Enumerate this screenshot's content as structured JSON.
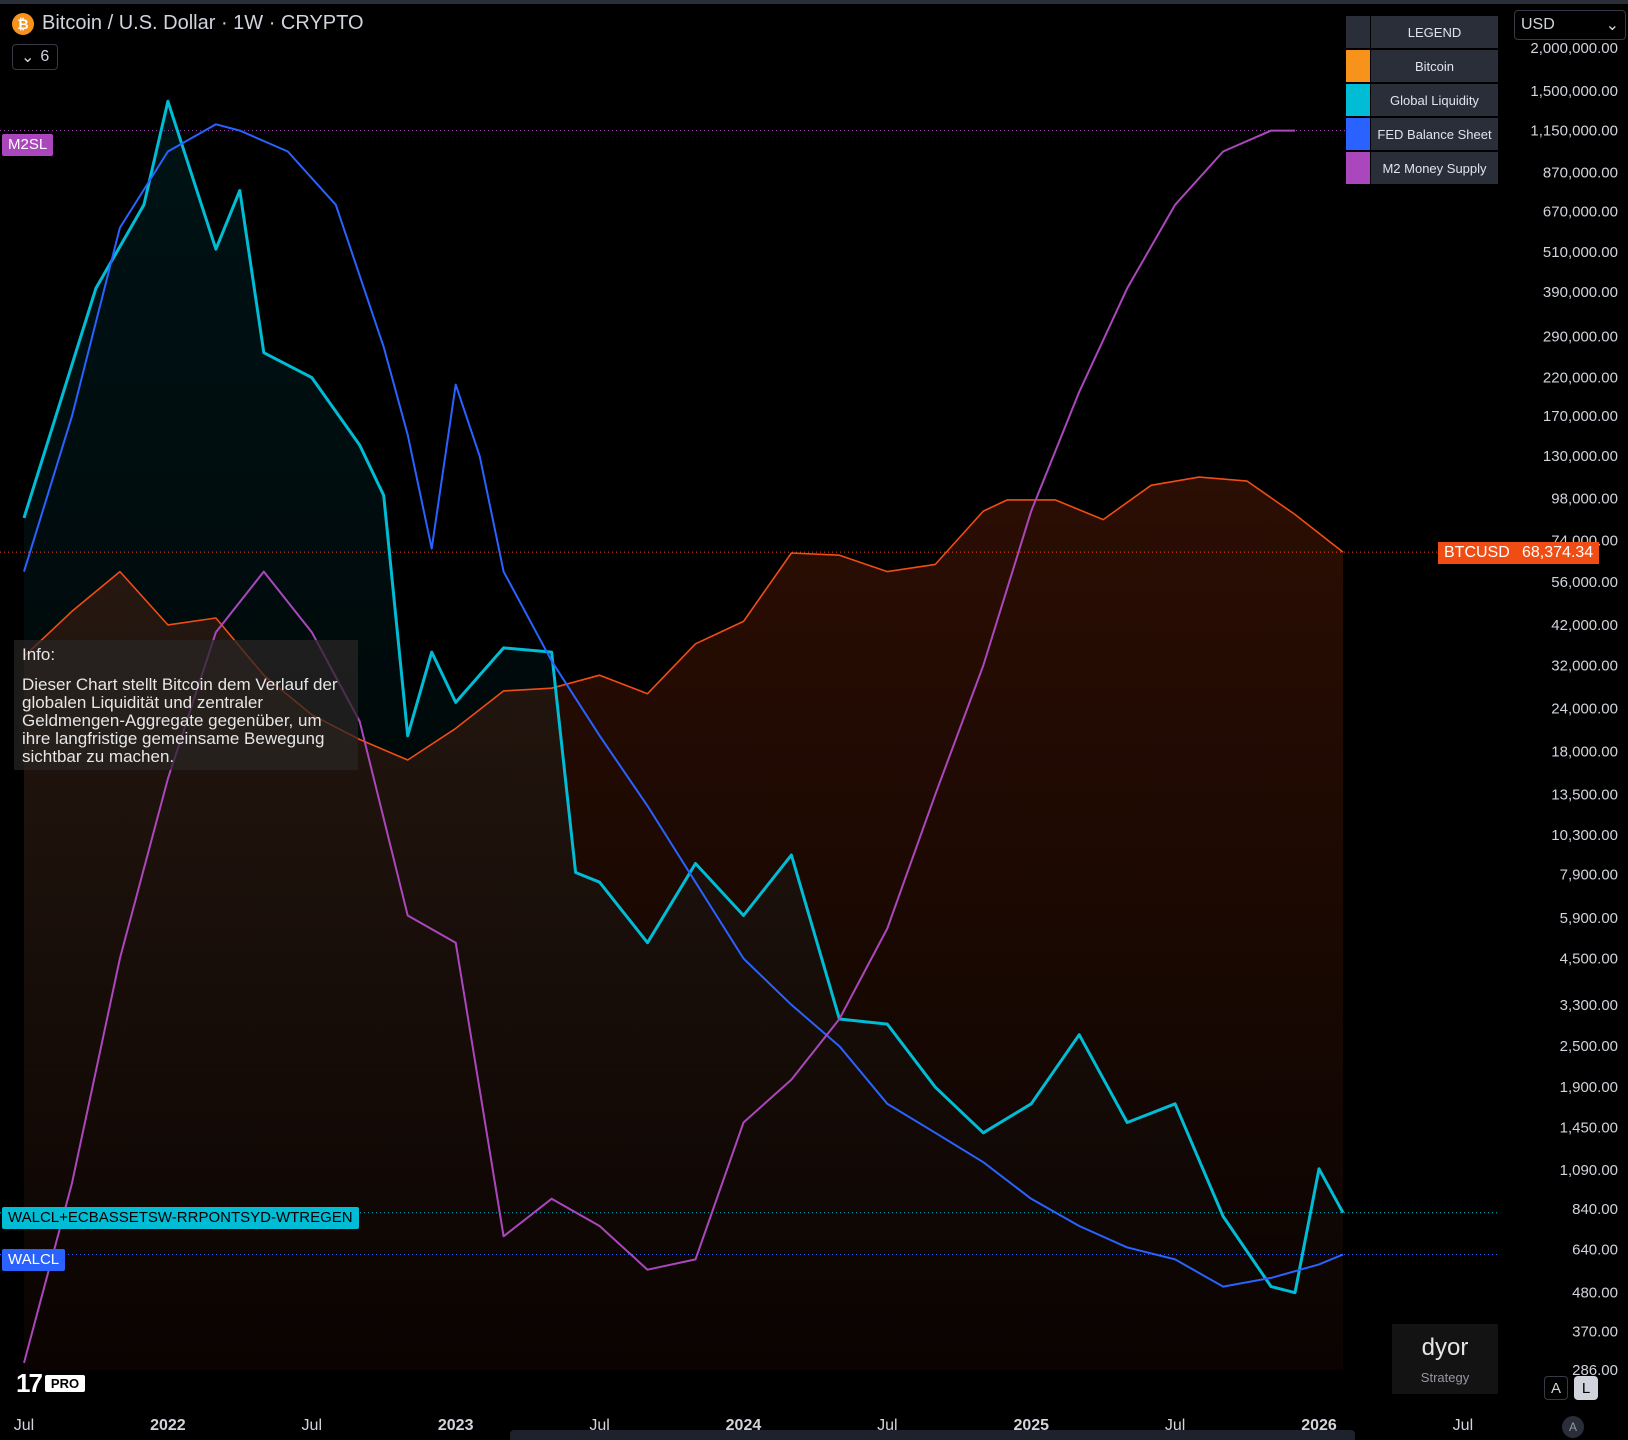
{
  "header": {
    "icon": "bitcoin-icon",
    "title": "Bitcoin / U.S. Dollar · 1W · CRYPTO",
    "collapse_count": "6"
  },
  "currency": {
    "selected": "USD"
  },
  "legend": {
    "title": "LEGEND",
    "items": [
      {
        "label": "Bitcoin",
        "color": "#f7931a"
      },
      {
        "label": "Global Liquidity",
        "color": "#00bcd4"
      },
      {
        "label": "FED Balance Sheet",
        "color": "#2962ff"
      },
      {
        "label": "M2 Money Supply",
        "color": "#ab47bc"
      }
    ]
  },
  "line_tags": {
    "m2": "M2SL",
    "global": "WALCL+ECBASSETSW-RRPONTSYD-WTREGEN",
    "fed": "WALCL"
  },
  "price_tag": {
    "symbol": "BTCUSD",
    "value": "68,374.34",
    "color": "#f04d14"
  },
  "info": {
    "title": "Info:",
    "text": "Dieser Chart stellt Bitcoin dem Verlauf der globalen Liquidität und zentraler Geldmengen-Aggregate gegenüber, um ihre langfristige gemeinsame Bewegung sichtbar zu machen."
  },
  "dyor": {
    "title": "dyor",
    "subtitle": "Strategy"
  },
  "axis_buttons": {
    "auto": "A",
    "log": "L",
    "auto_small": "A"
  },
  "brand": {
    "logo": "tradingview-logo",
    "badge": "PRO"
  },
  "chart_data": {
    "type": "line",
    "scale": "log",
    "y_axis_ticks": [
      "2,000,000.00",
      "1,500,000.00",
      "1,150,000.00",
      "870,000.00",
      "670,000.00",
      "510,000.00",
      "390,000.00",
      "290,000.00",
      "220,000.00",
      "170,000.00",
      "130,000.00",
      "98,000.00",
      "74,000.00",
      "56,000.00",
      "42,000.00",
      "32,000.00",
      "24,000.00",
      "18,000.00",
      "13,500.00",
      "10,300.00",
      "7,900.00",
      "5,900.00",
      "4,500.00",
      "3,300.00",
      "2,500.00",
      "1,900.00",
      "1,450.00",
      "1,090.00",
      "840.00",
      "640.00",
      "480.00",
      "370.00",
      "286.00"
    ],
    "x_axis_ticks": [
      "Jul",
      "2022",
      "Jul",
      "2023",
      "Jul",
      "2024",
      "Jul",
      "2025",
      "Jul",
      "2026",
      "Jul"
    ],
    "x_range": [
      "2021-07",
      "2026-08"
    ],
    "series": [
      {
        "name": "Bitcoin",
        "color": "#f04d14",
        "x": [
          "2021-07",
          "2021-09",
          "2021-11",
          "2022-01",
          "2022-03",
          "2022-05",
          "2022-07",
          "2022-09",
          "2022-11",
          "2023-01",
          "2023-03",
          "2023-05",
          "2023-07",
          "2023-09",
          "2023-11",
          "2024-01",
          "2024-03",
          "2024-05",
          "2024-07",
          "2024-09",
          "2024-11",
          "2024-12",
          "2025-02",
          "2025-04",
          "2025-06",
          "2025-08",
          "2025-10",
          "2025-12",
          "2026-02"
        ],
        "y": [
          34000,
          46000,
          60000,
          42000,
          44000,
          30000,
          23000,
          19500,
          17000,
          21000,
          27000,
          27500,
          30000,
          26500,
          37000,
          43000,
          68000,
          67000,
          60000,
          63000,
          90000,
          97000,
          97000,
          85000,
          107000,
          113000,
          110000,
          88000,
          68374
        ]
      },
      {
        "name": "Global Liquidity",
        "color": "#00bcd4",
        "x": [
          "2021-07",
          "2021-10",
          "2021-12",
          "2022-01",
          "2022-03",
          "2022-04",
          "2022-05",
          "2022-07",
          "2022-09",
          "2022-10",
          "2022-11",
          "2022-12",
          "2023-01",
          "2023-03",
          "2023-05",
          "2023-06",
          "2023-07",
          "2023-09",
          "2023-11",
          "2024-01",
          "2024-03",
          "2024-05",
          "2024-07",
          "2024-09",
          "2024-11",
          "2025-01",
          "2025-03",
          "2025-05",
          "2025-07",
          "2025-09",
          "2025-11",
          "2025-12",
          "2026-01",
          "2026-02"
        ],
        "y": [
          86000,
          400000,
          700000,
          1400000,
          520000,
          770000,
          260000,
          220000,
          140000,
          100000,
          20000,
          35000,
          25000,
          36000,
          35000,
          8000,
          7500,
          5000,
          8500,
          6000,
          9000,
          3000,
          2900,
          1900,
          1400,
          1700,
          2700,
          1500,
          1700,
          800,
          500,
          480,
          1100,
          820
        ]
      },
      {
        "name": "FED Balance Sheet",
        "color": "#2962ff",
        "x": [
          "2021-07",
          "2021-09",
          "2021-11",
          "2022-01",
          "2022-03",
          "2022-04",
          "2022-06",
          "2022-08",
          "2022-10",
          "2022-11",
          "2022-12",
          "2023-01",
          "2023-02",
          "2023-03",
          "2023-05",
          "2023-07",
          "2023-09",
          "2023-11",
          "2024-01",
          "2024-03",
          "2024-05",
          "2024-07",
          "2024-09",
          "2024-11",
          "2025-01",
          "2025-03",
          "2025-05",
          "2025-07",
          "2025-09",
          "2025-11",
          "2026-01",
          "2026-02"
        ],
        "y": [
          60000,
          170000,
          600000,
          1000000,
          1200000,
          1150000,
          1000000,
          700000,
          270000,
          150000,
          70000,
          210000,
          130000,
          60000,
          33000,
          20000,
          12500,
          7500,
          4500,
          3300,
          2500,
          1700,
          1400,
          1150,
          900,
          750,
          650,
          600,
          500,
          530,
          580,
          620
        ]
      },
      {
        "name": "M2 Money Supply",
        "color": "#ab47bc",
        "x": [
          "2021-07",
          "2021-09",
          "2021-11",
          "2022-01",
          "2022-03",
          "2022-05",
          "2022-07",
          "2022-09",
          "2022-11",
          "2023-01",
          "2023-03",
          "2023-05",
          "2023-07",
          "2023-09",
          "2023-11",
          "2024-01",
          "2024-03",
          "2024-05",
          "2024-07",
          "2024-09",
          "2024-11",
          "2025-01",
          "2025-03",
          "2025-05",
          "2025-07",
          "2025-09",
          "2025-11",
          "2025-12"
        ],
        "y": [
          300,
          1000,
          4500,
          15000,
          40000,
          60000,
          40000,
          22000,
          6000,
          5000,
          700,
          900,
          750,
          560,
          600,
          1500,
          2000,
          3000,
          5500,
          13500,
          32000,
          90000,
          200000,
          400000,
          700000,
          1000000,
          1150000,
          1150000
        ]
      }
    ]
  }
}
